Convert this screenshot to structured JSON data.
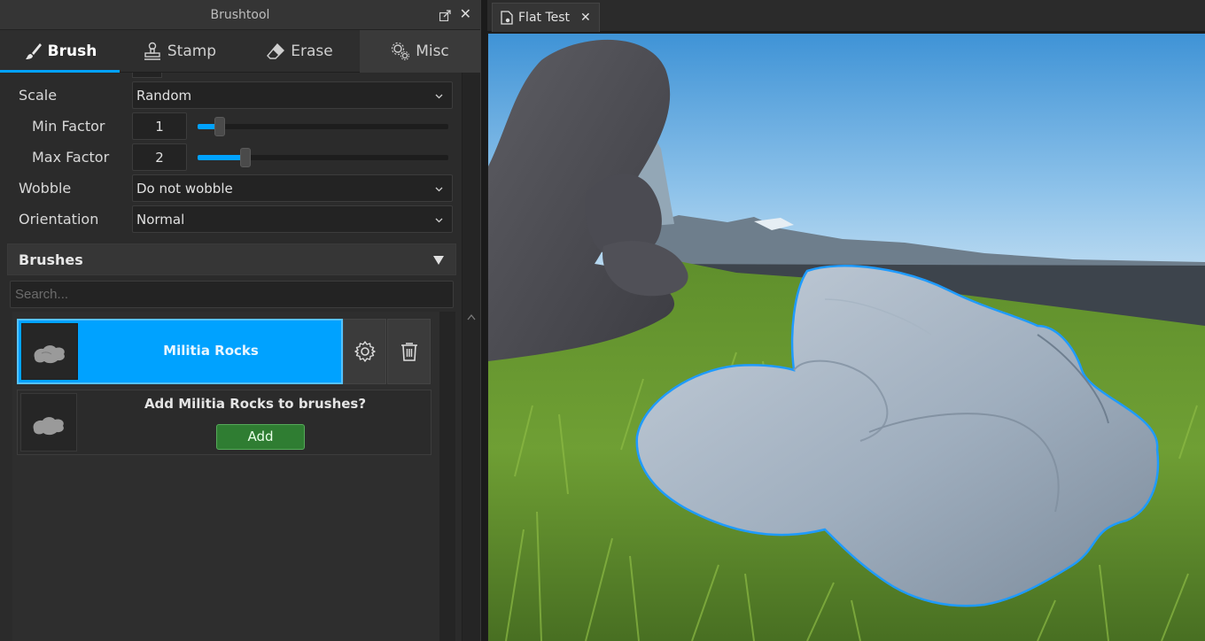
{
  "panel": {
    "title": "Brushtool",
    "tabs": [
      {
        "label": "Brush",
        "icon": "brush-icon",
        "active": true
      },
      {
        "label": "Stamp",
        "icon": "stamp-icon",
        "active": false
      },
      {
        "label": "Erase",
        "icon": "eraser-icon",
        "active": false
      },
      {
        "label": "Misc",
        "icon": "gears-icon",
        "active": false
      }
    ]
  },
  "settings": {
    "scale": {
      "label": "Scale",
      "value": "Random"
    },
    "min_factor": {
      "label": "Min Factor",
      "value": "1",
      "slider_fraction": 0.09
    },
    "max_factor": {
      "label": "Max Factor",
      "value": "2",
      "slider_fraction": 0.19
    },
    "wobble": {
      "label": "Wobble",
      "value": "Do not wobble"
    },
    "orientation": {
      "label": "Orientation",
      "value": "Normal"
    }
  },
  "brushes": {
    "header": "Brushes",
    "search_placeholder": "Search...",
    "items": [
      {
        "name": "Militia Rocks",
        "selected": true
      }
    ],
    "add_prompt": {
      "question": "Add Militia Rocks to brushes?",
      "button": "Add"
    }
  },
  "document": {
    "tab_label": "Flat Test"
  },
  "colors": {
    "accent": "#00a2ff",
    "add_button": "#2f7d32"
  }
}
